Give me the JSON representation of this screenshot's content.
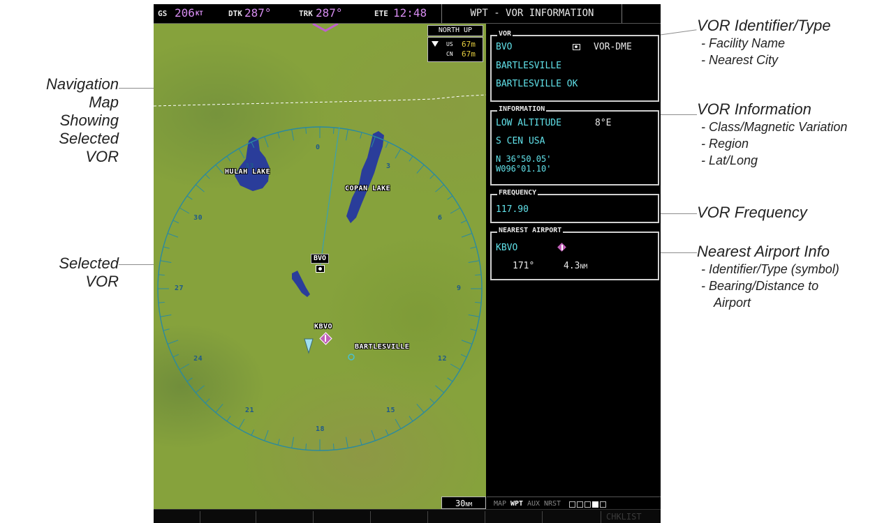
{
  "callouts": {
    "navigation_map": [
      "Navigation Map",
      "Showing",
      "Selected VOR"
    ],
    "selected_vor": "Selected VOR",
    "vor_identifier": {
      "head": "VOR Identifier/Type",
      "subs": [
        "- Facility Name",
        "- Nearest City"
      ]
    },
    "vor_information": {
      "head": "VOR Information",
      "subs": [
        "- Class/Magnetic Variation",
        "- Region",
        "- Lat/Long"
      ]
    },
    "vor_frequency": "VOR Frequency",
    "nearest_airport": {
      "head": "Nearest Airport Info",
      "subs": [
        "- Identifier/Type (symbol)",
        "- Bearing/Distance to",
        "Airport"
      ]
    }
  },
  "topbar": {
    "gs_label": "GS",
    "gs_value": "206",
    "gs_unit": "KT",
    "dtk_label": "DTK",
    "dtk_value": "287°",
    "trk_label": "TRK",
    "trk_value": "287°",
    "ete_label": "ETE",
    "ete_value": "12:48",
    "page_title": "WPT - VOR INFORMATION"
  },
  "map": {
    "orientation": "NORTH UP",
    "us_label": "US",
    "us_value": "67m",
    "cn_label": "CN",
    "cn_value": "67m",
    "compass_labels": [
      "33",
      "0",
      "3",
      "30",
      "6",
      "27",
      "9",
      "24",
      "12",
      "21",
      "15",
      "18"
    ],
    "lake_labels": [
      "HULAH LAKE",
      "COPAN LAKE"
    ],
    "vor_label": "BVO",
    "airport_label": "KBVO",
    "city_label": "BARTLESVILLE",
    "range": "30",
    "range_unit": "NM"
  },
  "vor_box": {
    "title": "VOR",
    "identifier": "BVO",
    "type": "VOR-DME",
    "facility_name": "BARTLESVILLE",
    "city": "BARTLESVILLE OK"
  },
  "info_box": {
    "title": "INFORMATION",
    "class": "LOW ALTITUDE",
    "mag_var": "8°E",
    "region": "S CEN USA",
    "lat": "N 36°50.05'",
    "lon": "W096°01.10'"
  },
  "freq_box": {
    "title": "FREQUENCY",
    "frequency": "117.90"
  },
  "airport_box": {
    "title": "NEAREST AIRPORT",
    "identifier": "KBVO",
    "bearing": "171°",
    "distance": "4.3",
    "distance_unit": "NM"
  },
  "page_group": {
    "groups": [
      "MAP",
      "WPT",
      "AUX",
      "NRST"
    ],
    "active": "WPT"
  },
  "softkeys": {
    "chklist": "CHKLIST"
  },
  "colors": {
    "cyan": "#60e0e8",
    "magenta": "#d68cf0",
    "map_green": "#86a23c",
    "lake_blue": "#2a3d9a"
  }
}
